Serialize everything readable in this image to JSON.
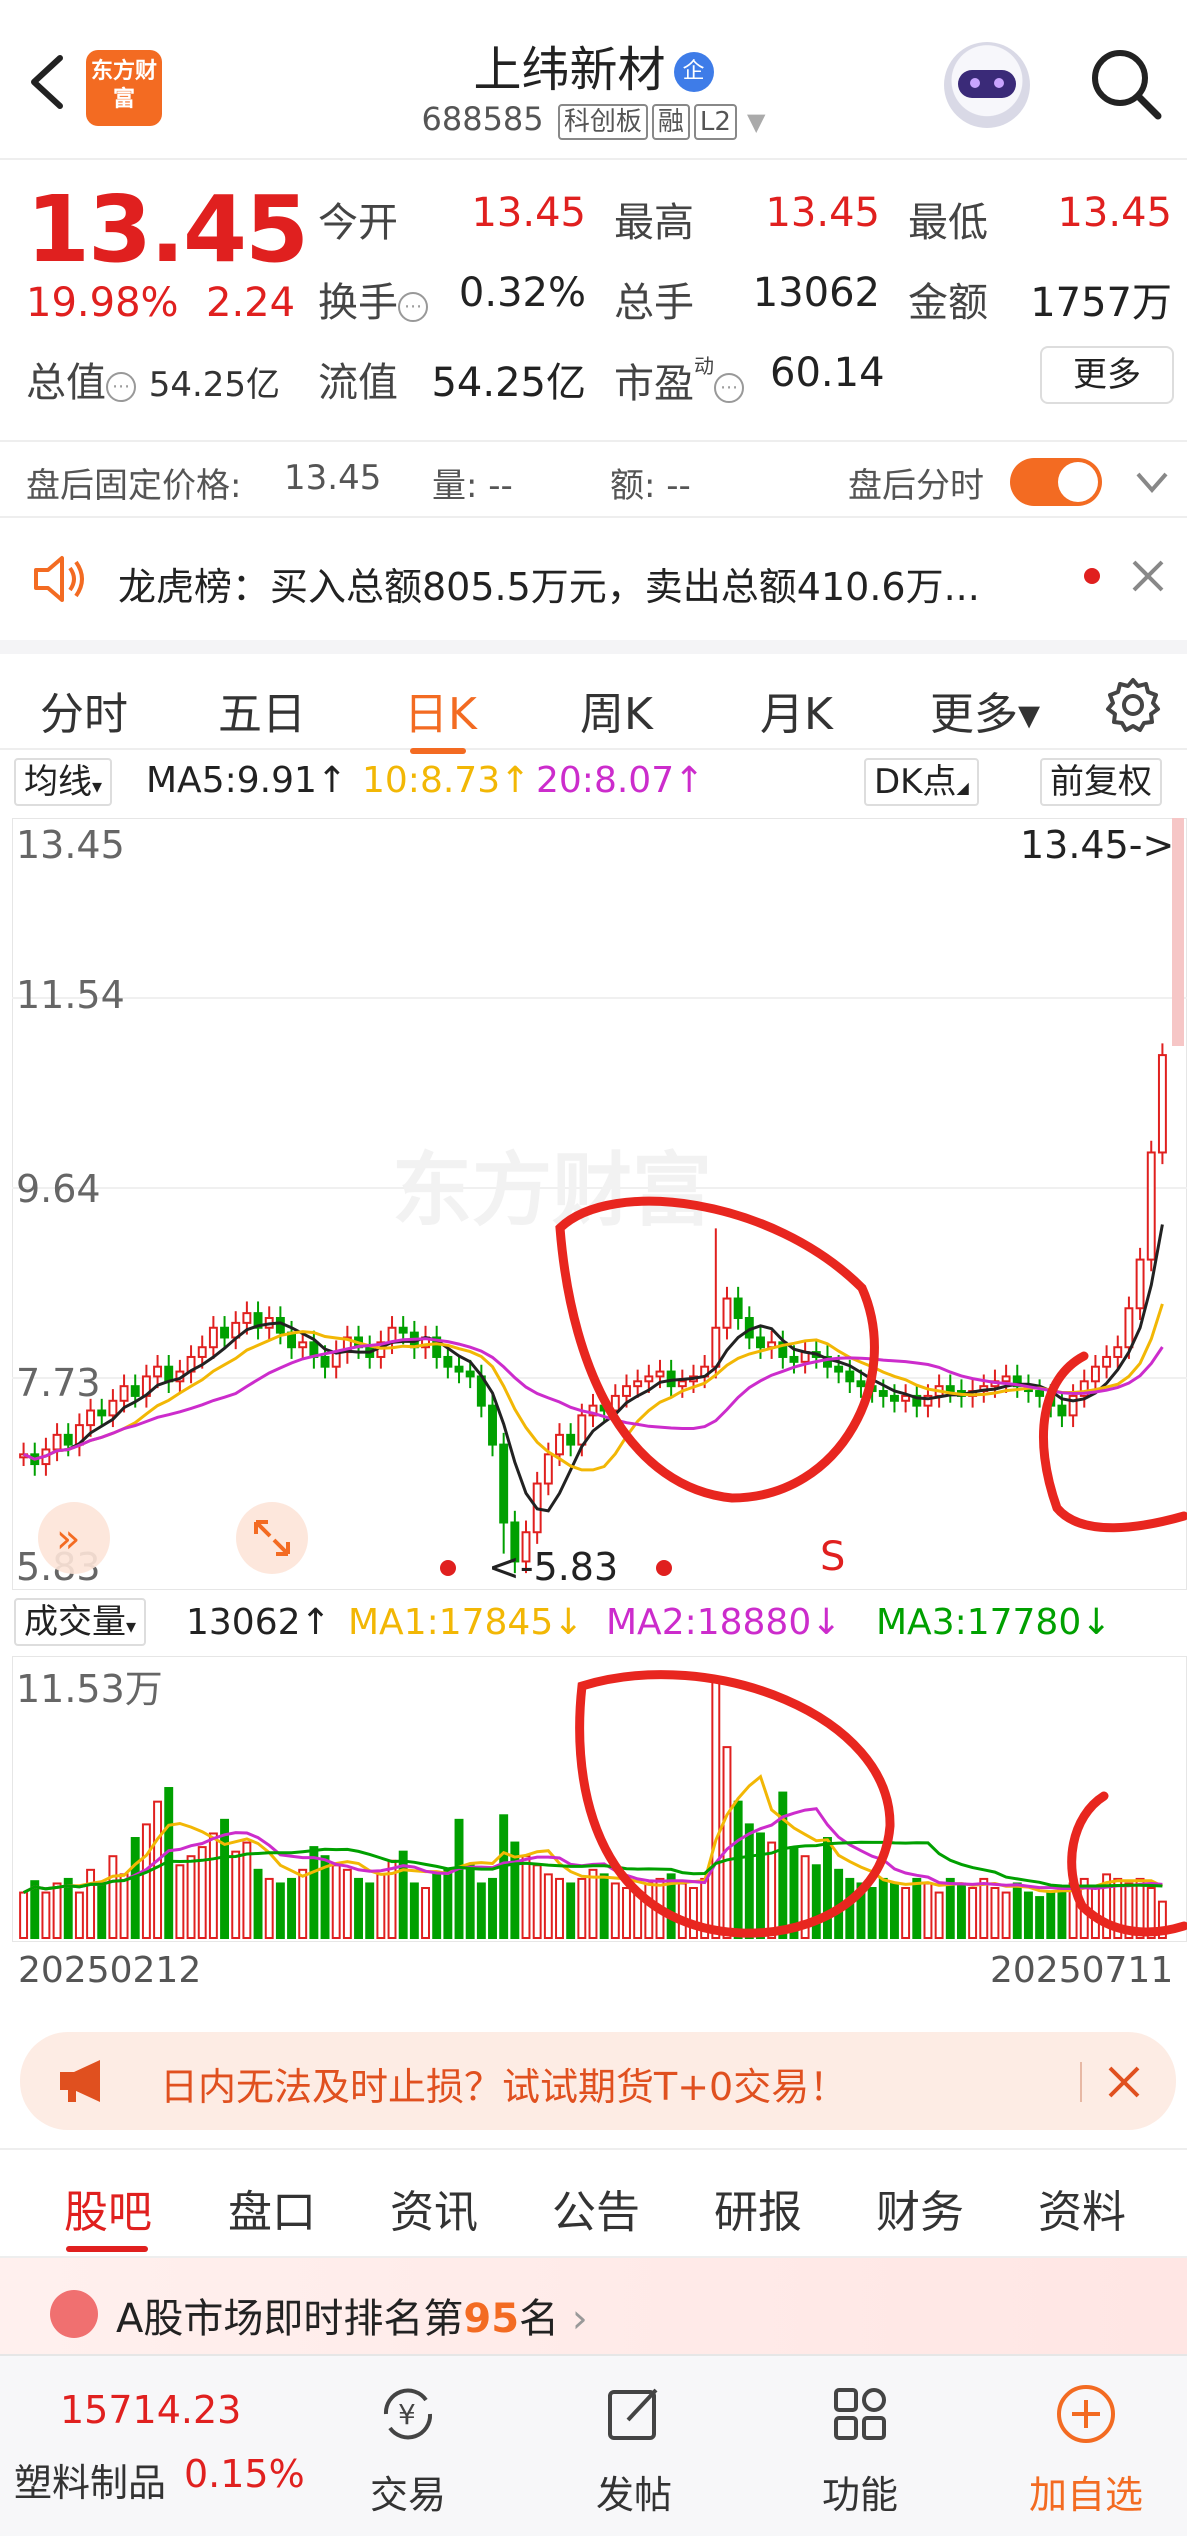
{
  "header": {
    "logo_text": "东方财富",
    "stock_name": "上纬新材",
    "ent_badge": "企",
    "code": "688585",
    "tags": [
      "科创板",
      "融",
      "L2"
    ]
  },
  "quote": {
    "price": "13.45",
    "change_pct": "19.98%",
    "change": "2.24",
    "mcap_label": "总值",
    "mcap_value": "54.25亿",
    "fields": [
      {
        "label": "今开",
        "value": "13.45",
        "color": "#e0201f"
      },
      {
        "label": "最高",
        "value": "13.45",
        "color": "#e0201f"
      },
      {
        "label": "最低",
        "value": "13.45",
        "color": "#e0201f"
      },
      {
        "label": "换手",
        "value": "0.32%",
        "color": "#222222"
      },
      {
        "label": "总手",
        "value": "13062",
        "color": "#222222"
      },
      {
        "label": "金额",
        "value": "1757万",
        "color": "#222222"
      },
      {
        "label": "流值",
        "value": "54.25亿",
        "color": "#222222"
      },
      {
        "label": "市盈",
        "value": "60.14",
        "color": "#222222"
      }
    ],
    "pe_superscript": "动",
    "more_label": "更多"
  },
  "after_hours": {
    "fixed_price_label": "盘后固定价格:",
    "fixed_price_value": "13.45",
    "volume_label": "量: --",
    "amount_label": "额: --",
    "toggle_label": "盘后分时",
    "toggle_on": true
  },
  "dragon_tiger": {
    "text": "龙虎榜：买入总额805.5万元，卖出总额410.6万..."
  },
  "chart_tabs": [
    "分时",
    "五日",
    "日K",
    "周K",
    "月K",
    "更多▾"
  ],
  "active_chart_tab": "日K",
  "ma_bar": {
    "selector": "均线",
    "ma5": "MA5:9.91↑",
    "ma10": "10:8.73↑",
    "ma20": "20:8.07↑",
    "dk_label": "DK点",
    "adjust_label": "前复权"
  },
  "colors": {
    "up": "#e0201f",
    "down": "#00a000",
    "ma5": "#222222",
    "ma10": "#f2b705",
    "ma20": "#cc2ccc",
    "accent": "#f36b22",
    "annotation": "#e8261f"
  },
  "chart_data": {
    "type": "candlestick",
    "price_axis_labels": [
      "13.45",
      "11.54",
      "9.64",
      "7.73",
      "5.83"
    ],
    "ylim": [
      5.83,
      13.45
    ],
    "last_price_marker": "13.45->",
    "min_marker": "<-5.83",
    "signal_label": "S",
    "start_date": "20250212",
    "end_date": "20250711",
    "closes": [
      7.1,
      7.0,
      7.15,
      7.3,
      7.2,
      7.4,
      7.55,
      7.5,
      7.65,
      7.8,
      7.7,
      7.9,
      8.0,
      7.85,
      7.95,
      8.1,
      8.2,
      8.4,
      8.3,
      8.45,
      8.55,
      8.4,
      8.5,
      8.35,
      8.2,
      8.25,
      8.1,
      8.0,
      8.15,
      8.3,
      8.2,
      8.1,
      8.25,
      8.4,
      8.35,
      8.2,
      8.3,
      8.1,
      8.0,
      7.95,
      7.9,
      7.6,
      7.2,
      6.4,
      6.0,
      6.3,
      6.8,
      7.1,
      7.3,
      7.2,
      7.5,
      7.6,
      7.55,
      7.7,
      7.8,
      7.85,
      7.9,
      7.95,
      7.8,
      7.85,
      7.9,
      8.0,
      8.4,
      8.7,
      8.5,
      8.3,
      8.2,
      8.25,
      8.1,
      8.05,
      8.15,
      8.1,
      8.0,
      7.95,
      7.85,
      7.8,
      7.75,
      7.7,
      7.65,
      7.7,
      7.6,
      7.7,
      7.8,
      7.75,
      7.7,
      7.75,
      7.8,
      7.85,
      7.9,
      7.8,
      7.75,
      7.7,
      7.6,
      7.5,
      7.7,
      7.85,
      8.0,
      8.1,
      8.2,
      8.6,
      9.1,
      10.2,
      11.2
    ],
    "volume_series": {
      "label": "成交量",
      "current": "13062↑",
      "ma1": "MA1:17845↓",
      "ma2": "MA2:18880↓",
      "ma3": "MA3:17780↓",
      "max_label": "11.53万",
      "values": [
        2,
        2.5,
        2,
        2.4,
        2.6,
        2,
        3,
        2.4,
        3.6,
        2.8,
        4.4,
        5,
        6,
        6.6,
        3.2,
        3.6,
        4,
        4.6,
        5.2,
        3.8,
        4.2,
        3,
        2.6,
        2.4,
        2.6,
        3,
        4,
        3.6,
        3.2,
        3,
        2.6,
        2.4,
        2.8,
        3.4,
        3.8,
        2.4,
        2.2,
        2.8,
        3,
        5.2,
        3.2,
        2.4,
        2.6,
        5.4,
        4.2,
        3.6,
        3.2,
        2.8,
        2.6,
        2.4,
        2.6,
        3,
        2.8,
        2.4,
        2.2,
        2,
        2.4,
        2.6,
        2.8,
        2.4,
        2.2,
        2.6,
        11.5,
        8.4,
        6,
        5,
        4.6,
        4.2,
        6.4,
        4,
        3.6,
        3.2,
        4.4,
        3,
        2.6,
        2.4,
        2.2,
        2.6,
        2.4,
        2.2,
        2.6,
        2.4,
        2,
        2.6,
        2.4,
        2.2,
        2.6,
        2.2,
        2,
        2.4,
        2,
        1.8,
        2,
        2.2,
        2.4,
        2.6,
        2.2,
        2.8,
        2.6,
        2.4,
        2.6,
        2.2,
        1.6
      ]
    }
  },
  "watermark": "东方财富",
  "promo": {
    "text": "日内无法及时止损？试试期货T+0交易！"
  },
  "info_tabs": [
    "股吧",
    "盘口",
    "资讯",
    "公告",
    "研报",
    "财务",
    "资料"
  ],
  "active_info_tab": "股吧",
  "rank_banner": {
    "prefix": "A股市场即时排名第",
    "rank": "95",
    "suffix": "名"
  },
  "bottom_bar": {
    "index_value": "15714.23",
    "index_name": "塑料制品",
    "index_pct": "0.15%",
    "items": [
      {
        "label": "交易",
        "icon": "yen-exchange-icon"
      },
      {
        "label": "发帖",
        "icon": "edit-icon"
      },
      {
        "label": "功能",
        "icon": "grid-icon"
      },
      {
        "label": "加自选",
        "icon": "add-circle-icon"
      }
    ]
  }
}
